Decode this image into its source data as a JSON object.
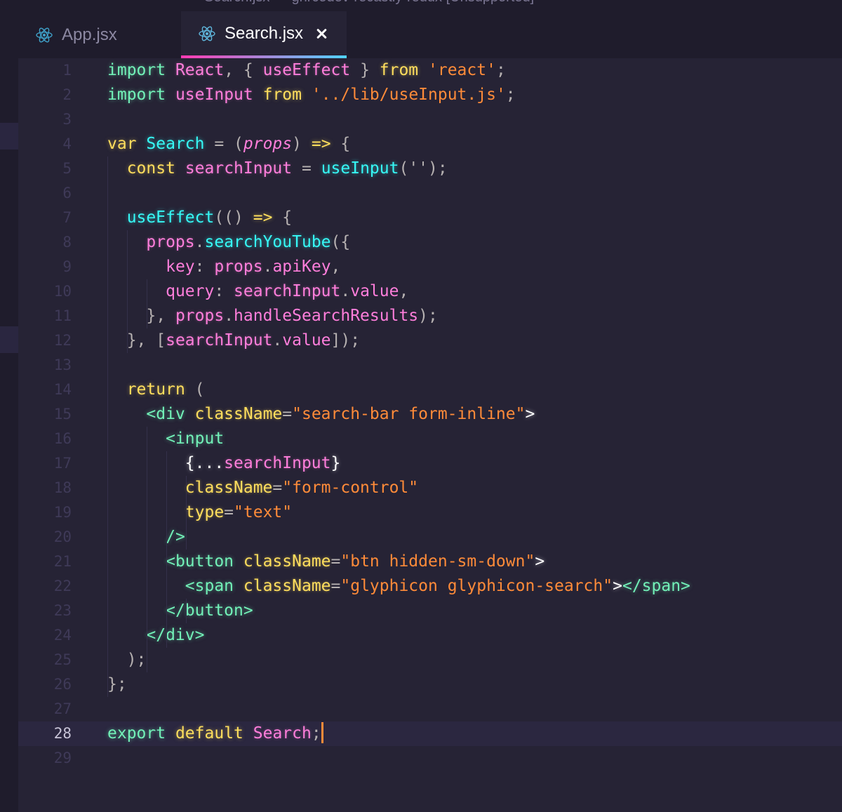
{
  "window": {
    "title": "Search.jsx — ghrcodev-recastly-redux [Unsupported]"
  },
  "tabs": [
    {
      "label": "App.jsx",
      "icon": "react-icon",
      "active": false
    },
    {
      "label": "Search.jsx",
      "icon": "react-icon",
      "active": true
    }
  ],
  "editor": {
    "current_line": "28",
    "lines": [
      {
        "n": "1",
        "tokens": [
          {
            "t": "import",
            "c": "kw"
          },
          {
            "t": " "
          },
          {
            "t": "React",
            "c": "var"
          },
          {
            "t": ", { ",
            "c": "punc"
          },
          {
            "t": "useEffect",
            "c": "var"
          },
          {
            "t": " } ",
            "c": "punc"
          },
          {
            "t": "from",
            "c": "kw2"
          },
          {
            "t": " "
          },
          {
            "t": "'react'",
            "c": "str"
          },
          {
            "t": ";",
            "c": "punc"
          }
        ]
      },
      {
        "n": "2",
        "tokens": [
          {
            "t": "import",
            "c": "kw"
          },
          {
            "t": " "
          },
          {
            "t": "useInput",
            "c": "var"
          },
          {
            "t": " "
          },
          {
            "t": "from",
            "c": "kw2"
          },
          {
            "t": " "
          },
          {
            "t": "'../lib/useInput.js'",
            "c": "str"
          },
          {
            "t": ";",
            "c": "punc"
          }
        ]
      },
      {
        "n": "3",
        "tokens": []
      },
      {
        "n": "4",
        "tokens": [
          {
            "t": "var",
            "c": "kw2"
          },
          {
            "t": " "
          },
          {
            "t": "Search",
            "c": "fn"
          },
          {
            "t": " = (",
            "c": "punc"
          },
          {
            "t": "props",
            "c": "param"
          },
          {
            "t": ") ",
            "c": "punc"
          },
          {
            "t": "=>",
            "c": "kw2"
          },
          {
            "t": " {",
            "c": "punc"
          }
        ]
      },
      {
        "n": "5",
        "tokens": [
          {
            "t": "  "
          },
          {
            "t": "const",
            "c": "kw2"
          },
          {
            "t": " "
          },
          {
            "t": "searchInput",
            "c": "var"
          },
          {
            "t": " = ",
            "c": "punc"
          },
          {
            "t": "useInput",
            "c": "fn"
          },
          {
            "t": "('');",
            "c": "punc"
          }
        ]
      },
      {
        "n": "6",
        "tokens": []
      },
      {
        "n": "7",
        "tokens": [
          {
            "t": "  "
          },
          {
            "t": "useEffect",
            "c": "fn"
          },
          {
            "t": "(() ",
            "c": "punc"
          },
          {
            "t": "=>",
            "c": "kw2"
          },
          {
            "t": " {",
            "c": "punc"
          }
        ]
      },
      {
        "n": "8",
        "tokens": [
          {
            "t": "    "
          },
          {
            "t": "props",
            "c": "var"
          },
          {
            "t": ".",
            "c": "punc"
          },
          {
            "t": "searchYouTube",
            "c": "fn"
          },
          {
            "t": "({",
            "c": "punc"
          }
        ]
      },
      {
        "n": "9",
        "tokens": [
          {
            "t": "      "
          },
          {
            "t": "key",
            "c": "prop"
          },
          {
            "t": ": ",
            "c": "punc"
          },
          {
            "t": "props",
            "c": "var"
          },
          {
            "t": ".",
            "c": "punc"
          },
          {
            "t": "apiKey",
            "c": "prop"
          },
          {
            "t": ",",
            "c": "punc"
          }
        ]
      },
      {
        "n": "10",
        "tokens": [
          {
            "t": "      "
          },
          {
            "t": "query",
            "c": "prop"
          },
          {
            "t": ": ",
            "c": "punc"
          },
          {
            "t": "searchInput",
            "c": "var"
          },
          {
            "t": ".",
            "c": "punc"
          },
          {
            "t": "value",
            "c": "prop"
          },
          {
            "t": ",",
            "c": "punc"
          }
        ]
      },
      {
        "n": "11",
        "tokens": [
          {
            "t": "    "
          },
          {
            "t": "}, ",
            "c": "punc"
          },
          {
            "t": "props",
            "c": "var"
          },
          {
            "t": ".",
            "c": "punc"
          },
          {
            "t": "handleSearchResults",
            "c": "prop"
          },
          {
            "t": ");",
            "c": "punc"
          }
        ]
      },
      {
        "n": "12",
        "tokens": [
          {
            "t": "  "
          },
          {
            "t": "}, [",
            "c": "punc"
          },
          {
            "t": "searchInput",
            "c": "var"
          },
          {
            "t": ".",
            "c": "punc"
          },
          {
            "t": "value",
            "c": "prop"
          },
          {
            "t": "]);",
            "c": "punc"
          }
        ]
      },
      {
        "n": "13",
        "tokens": []
      },
      {
        "n": "14",
        "tokens": [
          {
            "t": "  "
          },
          {
            "t": "return",
            "c": "kw2"
          },
          {
            "t": " (",
            "c": "punc"
          }
        ]
      },
      {
        "n": "15",
        "tokens": [
          {
            "t": "    "
          },
          {
            "t": "<div",
            "c": "tag"
          },
          {
            "t": " "
          },
          {
            "t": "className",
            "c": "attr"
          },
          {
            "t": "=",
            "c": "punc"
          },
          {
            "t": "\"search-bar form-inline\"",
            "c": "str"
          },
          {
            "t": ">",
            "c": "white"
          }
        ]
      },
      {
        "n": "16",
        "tokens": [
          {
            "t": "      "
          },
          {
            "t": "<input",
            "c": "tag"
          }
        ]
      },
      {
        "n": "17",
        "tokens": [
          {
            "t": "        "
          },
          {
            "t": "{...",
            "c": "white"
          },
          {
            "t": "searchInput",
            "c": "var"
          },
          {
            "t": "}",
            "c": "white"
          }
        ]
      },
      {
        "n": "18",
        "tokens": [
          {
            "t": "        "
          },
          {
            "t": "className",
            "c": "attr"
          },
          {
            "t": "=",
            "c": "punc"
          },
          {
            "t": "\"form-control\"",
            "c": "str"
          }
        ]
      },
      {
        "n": "19",
        "tokens": [
          {
            "t": "        "
          },
          {
            "t": "type",
            "c": "attr"
          },
          {
            "t": "=",
            "c": "punc"
          },
          {
            "t": "\"text\"",
            "c": "str"
          }
        ]
      },
      {
        "n": "20",
        "tokens": [
          {
            "t": "      "
          },
          {
            "t": "/>",
            "c": "tag"
          }
        ]
      },
      {
        "n": "21",
        "tokens": [
          {
            "t": "      "
          },
          {
            "t": "<button",
            "c": "tag"
          },
          {
            "t": " "
          },
          {
            "t": "className",
            "c": "attr"
          },
          {
            "t": "=",
            "c": "punc"
          },
          {
            "t": "\"btn hidden-sm-down\"",
            "c": "str"
          },
          {
            "t": ">",
            "c": "white"
          }
        ]
      },
      {
        "n": "22",
        "tokens": [
          {
            "t": "        "
          },
          {
            "t": "<span",
            "c": "tag"
          },
          {
            "t": " "
          },
          {
            "t": "className",
            "c": "attr"
          },
          {
            "t": "=",
            "c": "punc"
          },
          {
            "t": "\"glyphicon glyphicon-search\"",
            "c": "str"
          },
          {
            "t": ">",
            "c": "white"
          },
          {
            "t": "</span>",
            "c": "tag"
          }
        ]
      },
      {
        "n": "23",
        "tokens": [
          {
            "t": "      "
          },
          {
            "t": "</button>",
            "c": "tag"
          }
        ]
      },
      {
        "n": "24",
        "tokens": [
          {
            "t": "    "
          },
          {
            "t": "</div>",
            "c": "tag"
          }
        ]
      },
      {
        "n": "25",
        "tokens": [
          {
            "t": "  "
          },
          {
            "t": ");",
            "c": "punc"
          }
        ]
      },
      {
        "n": "26",
        "tokens": [
          {
            "t": "};",
            "c": "punc"
          }
        ]
      },
      {
        "n": "27",
        "tokens": []
      },
      {
        "n": "28",
        "tokens": [
          {
            "t": "export",
            "c": "kw"
          },
          {
            "t": " "
          },
          {
            "t": "default",
            "c": "kw2"
          },
          {
            "t": " "
          },
          {
            "t": "Search",
            "c": "var"
          },
          {
            "t": ";",
            "c": "punc"
          }
        ]
      },
      {
        "n": "29",
        "tokens": []
      }
    ]
  },
  "colors": {
    "background": "#262335",
    "keyword": "#72f1b8",
    "keyword2": "#fede5d",
    "variable": "#ff7edb",
    "function": "#36f9f6",
    "string": "#ff8b39",
    "cursor": "#ff8b39"
  }
}
